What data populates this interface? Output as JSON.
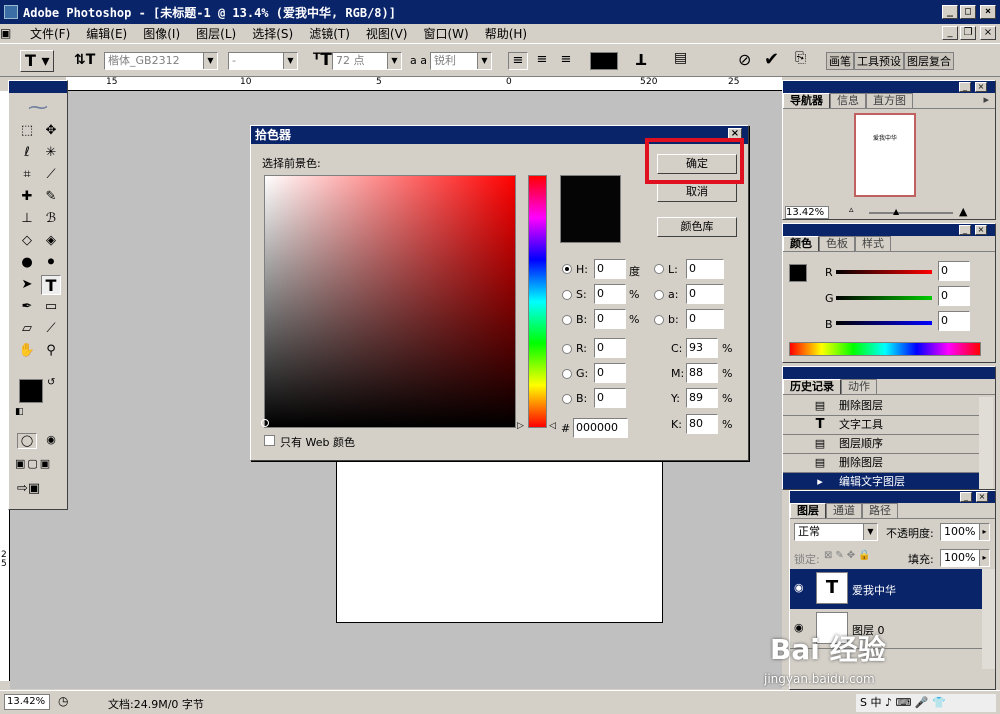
{
  "window": {
    "title": "Adobe Photoshop - [未标题-1 @ 13.4% (爱我中华, RGB/8)]"
  },
  "menu": [
    "文件(F)",
    "编辑(E)",
    "图像(I)",
    "图层(L)",
    "选择(S)",
    "滤镜(T)",
    "视图(V)",
    "窗口(W)",
    "帮助(H)"
  ],
  "options": {
    "font_family": "楷体_GB2312",
    "font_style": "-",
    "font_size": "72 点",
    "aa_label": "a a",
    "antialias": "锐利",
    "palette_tabs": [
      "画笔",
      "工具预设",
      "图层复合"
    ]
  },
  "ruler_ticks": [
    "15",
    "10",
    "5",
    "0",
    "5",
    "10",
    "15",
    "20",
    "25"
  ],
  "status": {
    "zoom": "13.42%",
    "doc": "文档:24.9M/0 字节"
  },
  "dialog": {
    "title": "拾色器",
    "subtitle": "选择前景色:",
    "ok": "确定",
    "cancel": "取消",
    "library": "颜色库",
    "web_only": "只有 Web 颜色",
    "fields": {
      "H": {
        "label": "H:",
        "value": "0",
        "unit": "度"
      },
      "S": {
        "label": "S:",
        "value": "0",
        "unit": "%"
      },
      "B": {
        "label": "B:",
        "value": "0",
        "unit": "%"
      },
      "R": {
        "label": "R:",
        "value": "0"
      },
      "G": {
        "label": "G:",
        "value": "0"
      },
      "Bb": {
        "label": "B:",
        "value": "0"
      },
      "L": {
        "label": "L:",
        "value": "0"
      },
      "a": {
        "label": "a:",
        "value": "0"
      },
      "b": {
        "label": "b:",
        "value": "0"
      },
      "C": {
        "label": "C:",
        "value": "93",
        "unit": "%"
      },
      "M": {
        "label": "M:",
        "value": "88",
        "unit": "%"
      },
      "Y": {
        "label": "Y:",
        "value": "89",
        "unit": "%"
      },
      "K": {
        "label": "K:",
        "value": "80",
        "unit": "%"
      },
      "hex": {
        "label": "#",
        "value": "000000"
      }
    },
    "selected_color": "#050505",
    "hue_color": "#ff0000"
  },
  "navigator": {
    "tabs": [
      "导航器",
      "信息",
      "直方图"
    ],
    "zoom": "13.42%",
    "thumb_text": "爱我中华"
  },
  "color_panel": {
    "tabs": [
      "颜色",
      "色板",
      "样式"
    ],
    "r_label": "R",
    "g_label": "G",
    "b_label": "B",
    "r": "0",
    "g": "0",
    "b": "0"
  },
  "history": {
    "tabs": [
      "历史记录",
      "动作"
    ],
    "items": [
      "删除图层",
      "文字工具",
      "图层顺序",
      "删除图层",
      "编辑文字图层"
    ]
  },
  "layers": {
    "tabs": [
      "图层",
      "通道",
      "路径"
    ],
    "blend": "正常",
    "opacity_label": "不透明度:",
    "opacity": "100%",
    "lock_label": "锁定:",
    "fill_label": "填充:",
    "fill": "100%",
    "items": [
      "爱我中华",
      "图层 0"
    ]
  },
  "watermark": {
    "text": "Bai 经验",
    "url": "jingyan.baidu.com"
  }
}
